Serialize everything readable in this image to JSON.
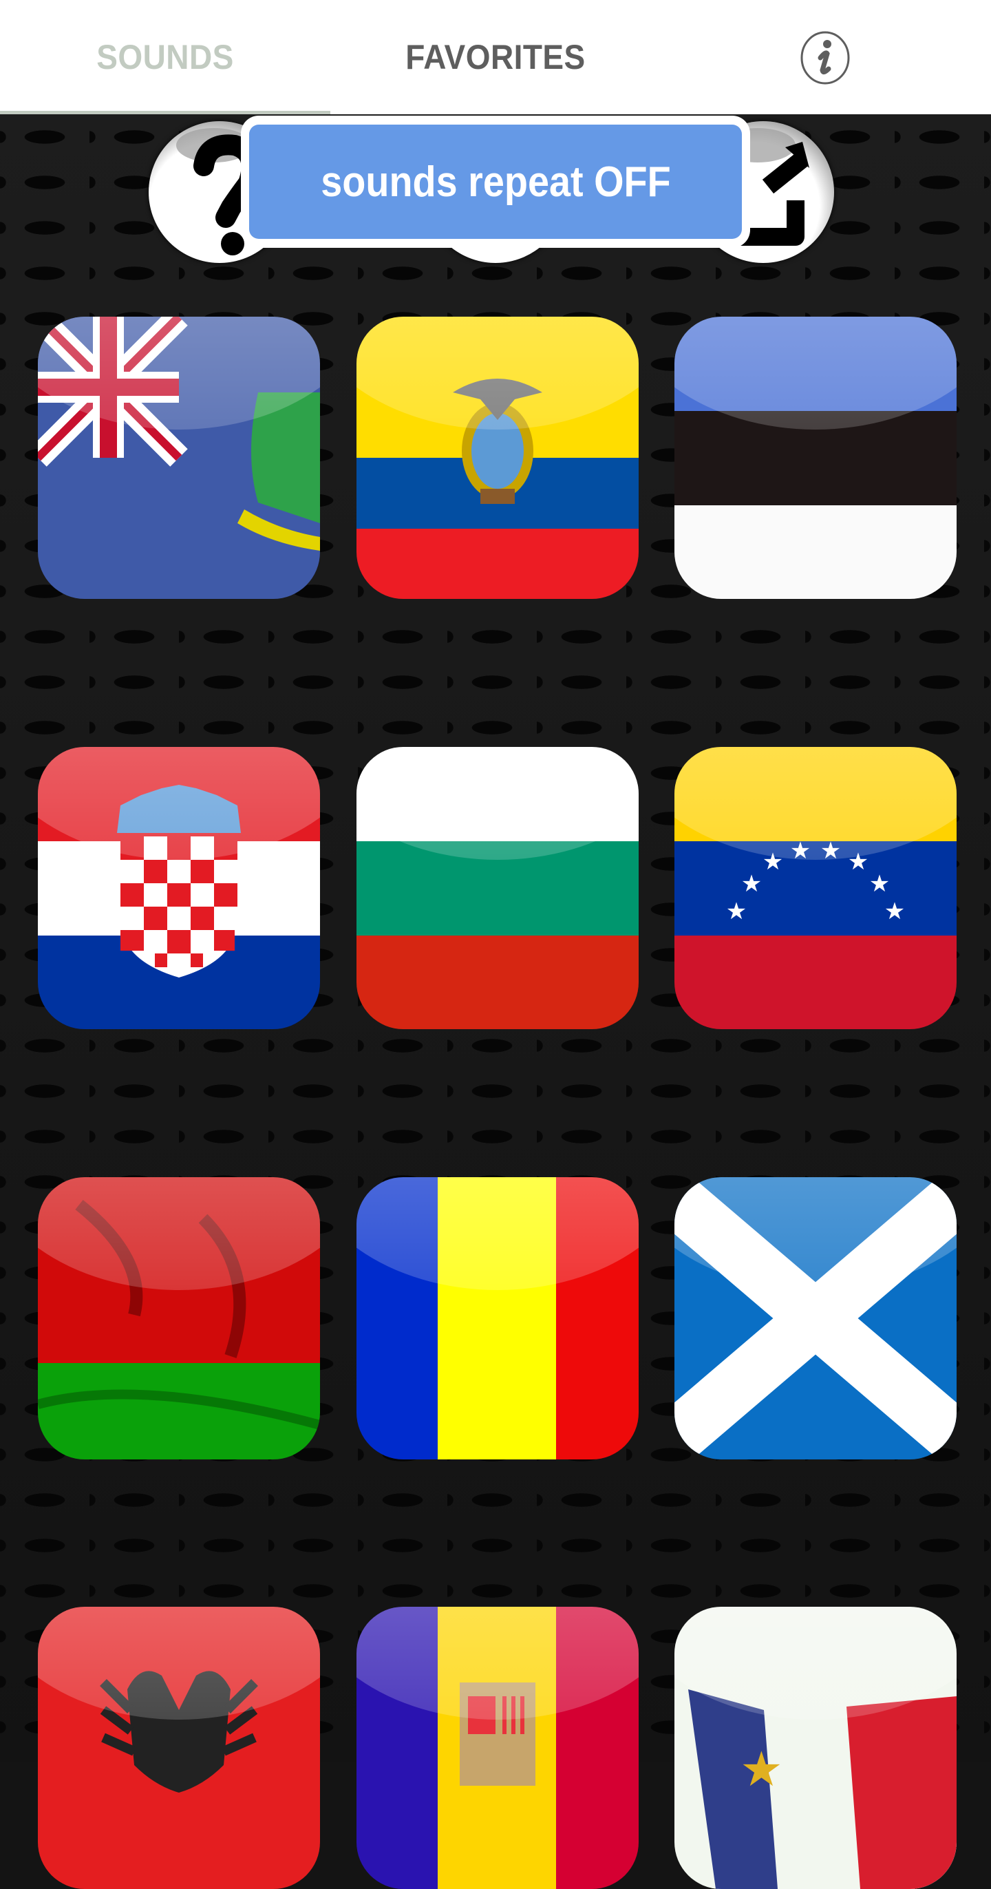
{
  "tabs": [
    {
      "label": "SOUNDS",
      "active": true
    },
    {
      "label": "FAVORITES",
      "active": false
    }
  ],
  "info_icon": "info-icon",
  "toolbar": {
    "buttons": [
      {
        "icon": "help-icon",
        "label": "?"
      },
      {
        "icon": "repeat-icon"
      },
      {
        "icon": "share-icon"
      }
    ]
  },
  "toast": {
    "text": "sounds repeat OFF"
  },
  "colors": {
    "tab_active": "#c2cbc1",
    "tab_inactive": "#5e5e5e",
    "toast_bg": "#6599e6"
  },
  "grid": {
    "items": [
      {
        "name": "Virgin Islands",
        "flag": "virgin-islands"
      },
      {
        "name": "Ecuador",
        "flag": "ecuador"
      },
      {
        "name": "Estonia",
        "flag": "estonia"
      },
      {
        "name": "Croatia",
        "flag": "croatia"
      },
      {
        "name": "Bulgaria",
        "flag": "bulgaria"
      },
      {
        "name": "Venezuela",
        "flag": "venezuela"
      },
      {
        "name": "Belarus",
        "flag": "belarus"
      },
      {
        "name": "Romania",
        "flag": "romania"
      },
      {
        "name": "Scotland",
        "flag": "scotland"
      },
      {
        "name": "",
        "flag": "albania"
      },
      {
        "name": "",
        "flag": "andorra"
      },
      {
        "name": "",
        "flag": "acadia"
      }
    ]
  }
}
